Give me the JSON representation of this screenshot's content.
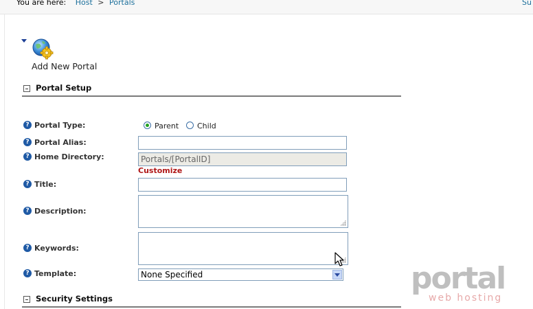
{
  "breadcrumb": {
    "prefix": "You are here:",
    "items": [
      "Host",
      "Portals"
    ],
    "separator": ">",
    "right_fragment": "Su"
  },
  "add_portal": {
    "label": "Add New Portal",
    "icon": "globe-gear-icon"
  },
  "portal_setup": {
    "title": "Portal Setup",
    "fields": {
      "portal_type": {
        "label": "Portal Type:",
        "options": [
          "Parent",
          "Child"
        ],
        "selected": "Parent"
      },
      "portal_alias": {
        "label": "Portal Alias:",
        "value": ""
      },
      "home_directory": {
        "label": "Home Directory:",
        "value": "Portals/[PortalID]",
        "link": "Customize"
      },
      "title": {
        "label": "Title:",
        "value": ""
      },
      "description": {
        "label": "Description:",
        "value": ""
      },
      "keywords": {
        "label": "Keywords:",
        "value": ""
      },
      "template": {
        "label": "Template:",
        "selected": "None Specified"
      }
    }
  },
  "security_settings": {
    "title": "Security Settings"
  },
  "watermark": {
    "line1": "portal",
    "line2": "web hosting"
  },
  "colors": {
    "link": "#1b6f9b",
    "customize": "#b01818",
    "help_icon": "#1f5aa5",
    "radio_checked": "#21a121",
    "watermark_gray": "#8c8c8c",
    "watermark_red": "#e7a9a9"
  }
}
